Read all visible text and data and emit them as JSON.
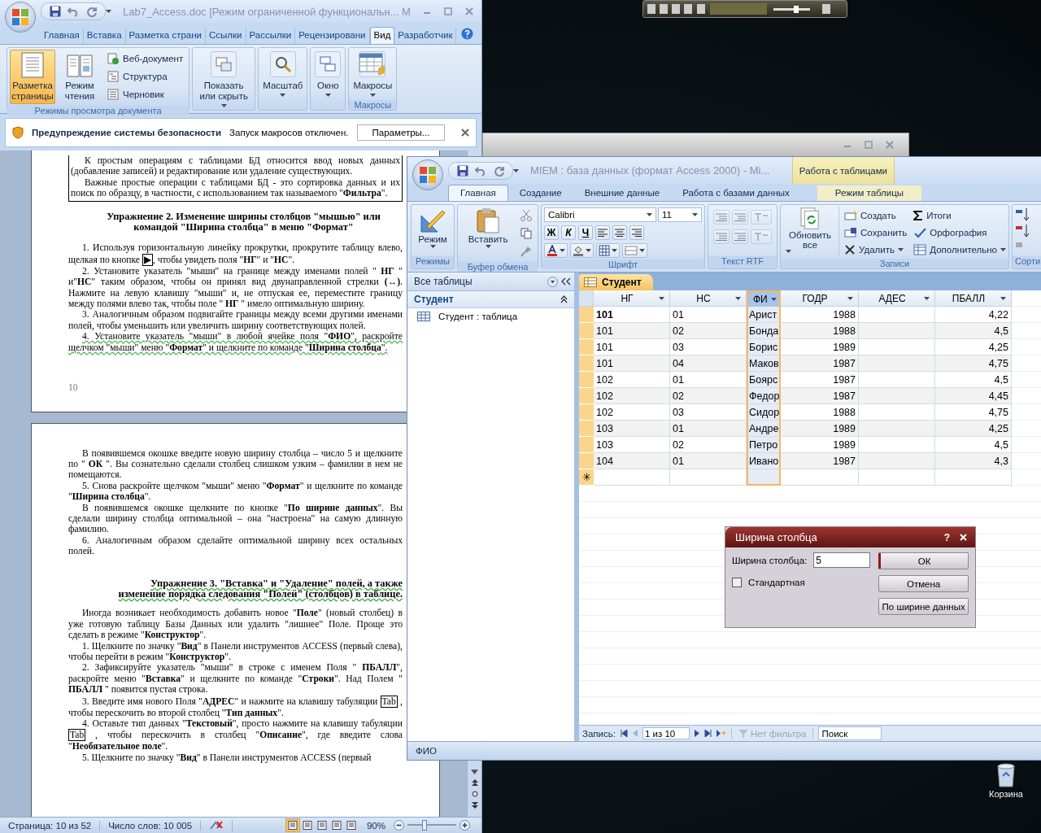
{
  "word": {
    "title": "Lab7_Access.doc [Режим ограниченной функциональн...  M",
    "tabs": [
      {
        "label": "Главная",
        "selected": false
      },
      {
        "label": "Вставка",
        "selected": false
      },
      {
        "label": "Разметка страни",
        "selected": false
      },
      {
        "label": "Ссылки",
        "selected": false
      },
      {
        "label": "Рассылки",
        "selected": false
      },
      {
        "label": "Рецензировани",
        "selected": false
      },
      {
        "label": "Вид",
        "selected": true
      },
      {
        "label": "Разработчик",
        "selected": false
      }
    ],
    "ribbon_groups": [
      {
        "label": "Режимы просмотра документа",
        "buttons": [
          {
            "kind": "large",
            "label": "Разметка страницы",
            "selected": true
          },
          {
            "kind": "large",
            "label": "Режим чтения",
            "selected": false
          },
          {
            "kind": "small",
            "label": "Веб-документ",
            "selected": false
          },
          {
            "kind": "small",
            "label": "Структура",
            "selected": false
          },
          {
            "kind": "small",
            "label": "Черновик",
            "selected": false
          }
        ]
      },
      {
        "buttons": [
          {
            "kind": "menu",
            "label": "Показать или скрыть"
          }
        ]
      },
      {
        "buttons": [
          {
            "kind": "menu",
            "label": "Масштаб"
          }
        ]
      },
      {
        "buttons": [
          {
            "kind": "menu",
            "label": "Окно"
          }
        ]
      },
      {
        "label": "Макросы",
        "buttons": [
          {
            "kind": "menu",
            "label": "Макросы"
          }
        ]
      }
    ],
    "security": {
      "title": "Предупреждение системы безопасности",
      "message": "Запуск макросов отключен.",
      "button": "Параметры..."
    },
    "pages": [
      {
        "blocks": [
          {
            "kind": "frame",
            "paragraphs": [
              {
                "text": "К простым операциям с таблицами БД относится ввод новых данных (добавление записей) и редактирование или удаление существующих."
              },
              {
                "text": "Важные простые операции с таблицами БД - это сортировка данных и их поиск по образцу, в частности, с использованием так называемого \"**Фильтра**\"."
              }
            ]
          },
          {
            "kind": "heading",
            "text": "Упражнение 2. Изменение ширины столбцов \"мышью\" или командой \"Ширина столбца\" в меню \"Формат\"",
            "flagged": false
          },
          {
            "kind": "para",
            "flagged": false,
            "parts": [
              {
                "kind": "text",
                "text": "1. Используя горизонтальную линейку прокрутки, прокрутите таблицу влево, щелкая по кнопке "
              },
              {
                "kind": "key",
                "text": "▶"
              },
              {
                "kind": "text",
                "text": ", чтобы увидеть поля \"**НГ**\" и \"**НС**\"."
              }
            ]
          },
          {
            "kind": "para",
            "flagged": false,
            "text": "2. Установите указатель \"мыши\" на границе между именами полей \" **НГ** \" и\"**НС**\" таким образом, чтобы он принял вид двунаправленной стрелки **(↔)**. Нажмите на левую клавишу \"мыши\" и, не отпуская ее, переместите границу между полями влево так, чтобы поле \" **НГ** \" имело оптимальную ширину."
          },
          {
            "kind": "para",
            "flagged": false,
            "text": "3. Аналогичным образом подвигайте границы между всеми другими именами полей, чтобы уменьшить или увеличить ширину соответствующих полей."
          },
          {
            "kind": "para",
            "flagged": true,
            "text": "4. Установите указатель \"мыши\" в любой ячейке поля \"**ФИО**\", раскройте щелчком \"мыши\" меню \"**Формат**\" и щелкните по команде \"**Ширина столбца**\"."
          }
        ],
        "page_number": "10"
      },
      {
        "blocks": [
          {
            "kind": "para",
            "flagged": false,
            "text": "В появившемся окошке введите новую ширину столбца – число 5 и щелкните по \" **ОК** \". Вы сознательно сделали столбец слишком узким – фамилии в нем не помещаются."
          },
          {
            "kind": "para",
            "flagged": false,
            "text": "5. Снова раскройте щелчком \"мыши\" меню \"**Формат**\" и щелкните по команде \"**Ширина столбца**\"."
          },
          {
            "kind": "para",
            "flagged": false,
            "text": "В появившемся окошке щелкните по кнопке \"**По ширине данных**\". Вы сделали ширину столбца оптимальной – она \"настроена\" на самую длинную фамилию."
          },
          {
            "kind": "para",
            "flagged": false,
            "text": "6. Аналогичным образом сделайте оптимальной ширину всех остальных полей."
          },
          {
            "kind": "heading",
            "flagged": true,
            "text": "Упражнение 3. \"Вставка\" и \"Удаление\" полей, а также изменение порядка следования \"Полей\" (столбцов) в таблице."
          },
          {
            "kind": "para",
            "flagged": false,
            "text": "Иногда возникает необходимость добавить новое \"**Поле**\" (новый столбец) в уже готовую таблицу Базы Данных или удалить \"лишнее\" Поле. Проще это сделать в режиме \"**Конструктор**\"."
          },
          {
            "kind": "para",
            "flagged": false,
            "text": "1. Щелкните по значку \"**Вид**\" в Панели инструментов ACCESS (первый слева), чтобы перейти в режим \"**Конструктор**\"."
          },
          {
            "kind": "para",
            "flagged": false,
            "text": "2. Зафиксируйте указатель \"мыши\" в строке с именем Поля \" **ПБАЛЛ**\", раскройте меню \"**Вставка**\" и щелкните по команде \"**Строки**\". Над Полем \" **ПБАЛЛ** \" появится пустая строка."
          },
          {
            "kind": "para",
            "flagged": false,
            "parts": [
              {
                "kind": "text",
                "text": "3. Введите имя нового Поля \"**АДРЕС**\" и нажмите на клавишу табуляции "
              },
              {
                "kind": "key",
                "text": "Tab"
              },
              {
                "kind": "text",
                "text": " , чтобы перескочить во второй столбец \"**Тип данных**\"."
              }
            ]
          },
          {
            "kind": "para",
            "flagged": false,
            "parts": [
              {
                "kind": "text",
                "text": "4. Оставьте тип данных \"**Текстовый**\", просто нажмите на клавишу табуляции "
              },
              {
                "kind": "key",
                "text": "Tab"
              },
              {
                "kind": "text",
                "text": " , чтобы перескочить в столбец \"**Описание**\", где введите слова \"**Необязательное поле**\"."
              }
            ]
          },
          {
            "kind": "para",
            "flagged": false,
            "text": "5. Щелкните по значку \"**Вид**\" в Панели инструментов ACCESS (первый"
          }
        ]
      }
    ],
    "status": {
      "page": "Страница: 10 из 52",
      "words": "Число слов: 10 005",
      "views": [
        {
          "selected": true
        },
        {
          "selected": false
        },
        {
          "selected": false
        },
        {
          "selected": false
        },
        {
          "selected": false
        }
      ],
      "zoom": "90%",
      "zoom_slider": {
        "level": 0.35
      }
    }
  },
  "access": {
    "title": "MIEM : база данных (формат Access 2000)  -  Mi...",
    "context_header": "Работа с таблицами",
    "tabs": [
      {
        "label": "Главная",
        "selected": true,
        "contextual": false
      },
      {
        "label": "Создание",
        "selected": false,
        "contextual": false
      },
      {
        "label": "Внешние данные",
        "selected": false,
        "contextual": false
      },
      {
        "label": "Работа с базами данных",
        "selected": false,
        "contextual": false
      },
      {
        "label": "Режим таблицы",
        "selected": false,
        "contextual": true
      }
    ],
    "ribbon": {
      "view": {
        "label": "Режимы",
        "button": "Режим"
      },
      "clipboard": {
        "label": "Буфер обмена",
        "button": "Вставить"
      },
      "font": {
        "label": "Шрифт",
        "font_name": "Calibri",
        "font_size": "11",
        "bold": "Ж",
        "italic": "К",
        "underline": "Ч"
      },
      "rich_text": {
        "label": "Текст RTF"
      },
      "records": {
        "label": "Записи",
        "refresh": "Обновить все",
        "items": [
          {
            "label": "Создать",
            "dropdown": false
          },
          {
            "label": "Сохранить",
            "dropdown": false
          },
          {
            "label": "Удалить",
            "dropdown": true
          },
          {
            "label": "Итоги",
            "dropdown": false
          },
          {
            "label": "Орфография",
            "dropdown": false
          },
          {
            "label": "Дополнительно",
            "dropdown": true
          }
        ]
      },
      "sort": {
        "label": "Сорти"
      }
    },
    "nav": {
      "header": "Все таблицы",
      "group": "Студент",
      "items": [
        {
          "label": "Студент : таблица"
        }
      ]
    },
    "datasheet": {
      "tab": "Студент",
      "columns": [
        {
          "label": "НГ",
          "kind": "text",
          "selected": false
        },
        {
          "label": "НС",
          "kind": "text",
          "selected": false
        },
        {
          "label": "ФИ",
          "kind": "text",
          "selected": true
        },
        {
          "label": "ГОДР",
          "kind": "number",
          "selected": false
        },
        {
          "label": "АДЕС",
          "kind": "text",
          "selected": false
        },
        {
          "label": "ПБАЛЛ",
          "kind": "number",
          "selected": false
        }
      ],
      "rows": [
        {
          "current": true,
          "cells": [
            "101",
            "01",
            "Арист",
            "1988",
            "",
            "4,22"
          ]
        },
        {
          "current": false,
          "cells": [
            "101",
            "02",
            "Бонда",
            "1988",
            "",
            "4,5"
          ]
        },
        {
          "current": false,
          "cells": [
            "101",
            "03",
            "Борис",
            "1989",
            "",
            "4,25"
          ]
        },
        {
          "current": false,
          "cells": [
            "101",
            "04",
            "Маков",
            "1987",
            "",
            "4,75"
          ]
        },
        {
          "current": false,
          "cells": [
            "102",
            "01",
            "Боярс",
            "1987",
            "",
            "4,5"
          ]
        },
        {
          "current": false,
          "cells": [
            "102",
            "02",
            "Федор",
            "1987",
            "",
            "4,45"
          ]
        },
        {
          "current": false,
          "cells": [
            "102",
            "03",
            "Сидор",
            "1988",
            "",
            "4,75"
          ]
        },
        {
          "current": false,
          "cells": [
            "103",
            "01",
            "Андре",
            "1989",
            "",
            "4,25"
          ]
        },
        {
          "current": false,
          "cells": [
            "103",
            "02",
            "Петро",
            "1989",
            "",
            "4,5"
          ]
        },
        {
          "current": false,
          "cells": [
            "104",
            "01",
            "Ивано",
            "1987",
            "",
            "4,3"
          ]
        }
      ],
      "new_row_mark": "✳"
    },
    "record_nav": {
      "label": "Запись:",
      "position": "1 из 10",
      "filter": "Нет фильтра",
      "search_placeholder": "Поиск"
    },
    "status": "ФИО"
  },
  "dialog": {
    "title": "Ширина столбца",
    "help": "?",
    "field_label": "Ширина столбца:",
    "value": "5",
    "checkbox": {
      "label": "Стандартная",
      "checked": false
    },
    "buttons": [
      {
        "label": "ОК",
        "default": true
      },
      {
        "label": "Отмена",
        "default": false
      },
      {
        "label": "По ширине данных",
        "default": false
      }
    ]
  },
  "desktop": {
    "icons": [
      {
        "label": "Корзина"
      }
    ]
  }
}
